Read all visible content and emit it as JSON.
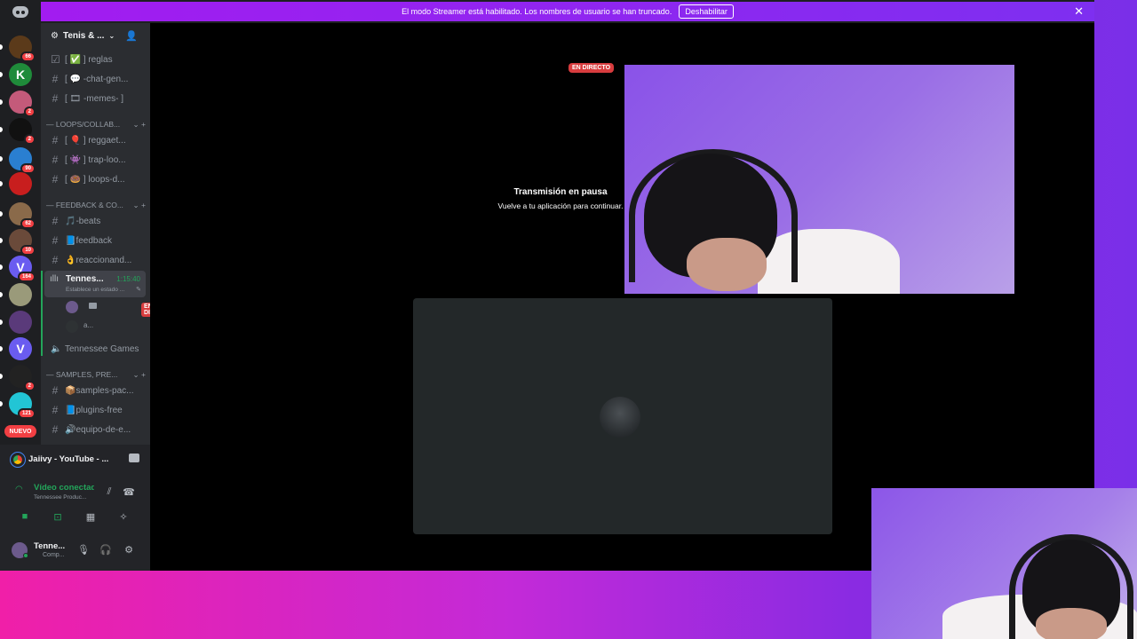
{
  "banner": {
    "text": "El modo Streamer está habilitado. Los nombres de usuario se han truncado.",
    "button": "Deshabilitar",
    "close": "✕"
  },
  "server_rail": {
    "items": [
      {
        "glyph": "",
        "badge": "66",
        "color": "#5b3a1a"
      },
      {
        "glyph": "K",
        "badge": "",
        "color": "#1f8b3a"
      },
      {
        "glyph": "",
        "badge": "2",
        "color": "#c45a7a"
      },
      {
        "glyph": "",
        "badge": "2",
        "color": "#111111"
      },
      {
        "glyph": "",
        "badge": "90",
        "color": "#2a7fd1"
      },
      {
        "glyph": "",
        "badge": "",
        "color": "#c81e1e"
      },
      {
        "glyph": "",
        "badge": "62",
        "color": "#8a6a4a"
      },
      {
        "glyph": "",
        "badge": "10",
        "color": "#6a4a3a"
      },
      {
        "glyph": "V",
        "badge": "164",
        "color": "#6a5cf0"
      },
      {
        "glyph": "",
        "badge": "",
        "color": "#9a9a7a"
      },
      {
        "glyph": "",
        "badge": "",
        "color": "#5a3a7a"
      },
      {
        "glyph": "V",
        "badge": "",
        "color": "#6a5cf0"
      },
      {
        "glyph": "",
        "badge": "2",
        "color": "#222222"
      },
      {
        "glyph": "",
        "badge": "121",
        "color": "#22c5d5"
      }
    ],
    "new_label": "NUEVO"
  },
  "server": {
    "name": "Tenis & ..."
  },
  "channels": {
    "rules": "[ ✅ ] reglas",
    "chat": "[ 💬 -chat-gen...",
    "memes": "[ 🎞 -memes- ]",
    "cat_loops": "— LOOPS/COLLAB...",
    "reggaeton": "[ 🎈 ] reggaet...",
    "trap": "[ 👾 ] trap-loo...",
    "loops": "[ 🍩 ] loops-d...",
    "cat_feedback": "— FEEDBACK & CO...",
    "beats": "🎵-beats",
    "feedback": "📘feedback",
    "reacciones": "👌reaccionand...",
    "voice_name": "Tennes...",
    "voice_time": "1:15:40",
    "voice_status": "Establece un estado ...",
    "live_label": "EN DIRECTO",
    "member_two": "a...",
    "games": "Tennessee Games",
    "cat_samples": "— SAMPLES, PRE...",
    "samples": "📦samples-pac...",
    "plugins": "📘plugins-free",
    "equipo": "🔊equipo-de-e..."
  },
  "panel": {
    "activity": "Jaiivy - YouTube - ...",
    "video_status": "Vídeo conectado",
    "video_channel": "Tennessee Produc...",
    "user_name": "Tenne...",
    "user_status": "Comp..."
  },
  "stage": {
    "pause_title": "Transmisión en pausa",
    "pause_sub": "Vuelve a tu aplicación para continuar.",
    "live_label": "EN DIRECTO"
  },
  "colors": {
    "live": "#d83c3e",
    "connected": "#23a55a",
    "banner": "#a21cf0"
  }
}
